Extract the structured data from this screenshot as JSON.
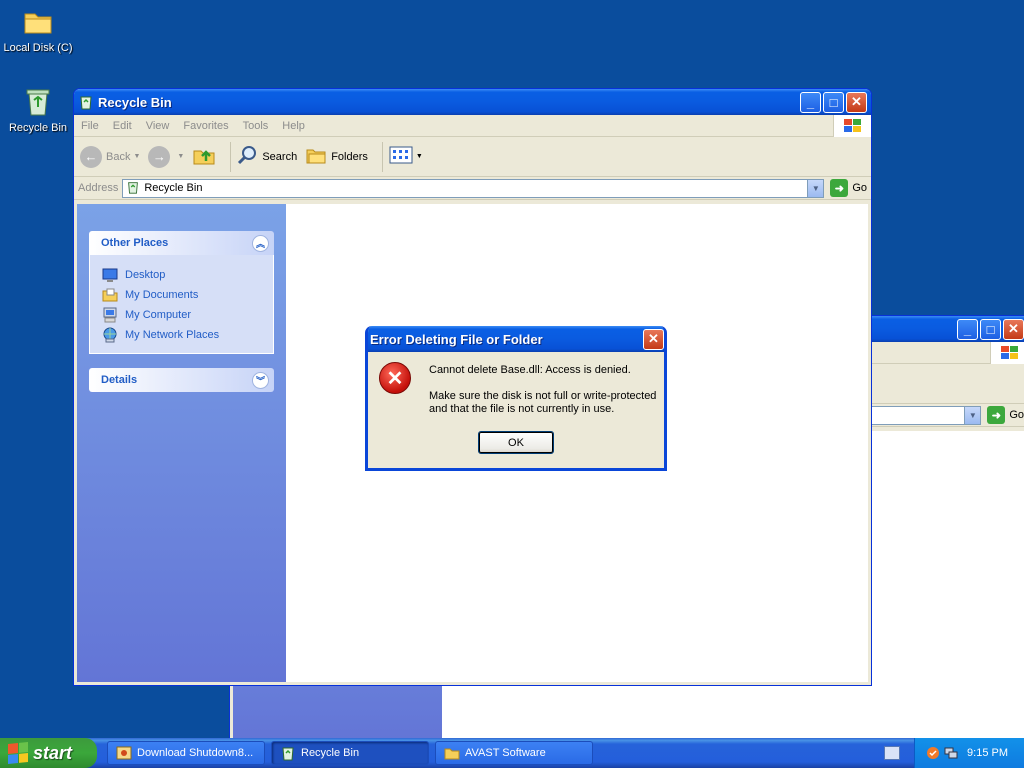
{
  "desktop": {
    "icons": [
      {
        "label": "Local Disk (C)",
        "icon": "folder-icon"
      },
      {
        "label": "Recycle Bin",
        "icon": "recycle-bin-icon"
      }
    ]
  },
  "explorer": {
    "title": "Recycle Bin",
    "menu": [
      "File",
      "Edit",
      "View",
      "Favorites",
      "Tools",
      "Help"
    ],
    "toolbar": {
      "back": "Back",
      "search": "Search",
      "folders": "Folders"
    },
    "address": {
      "label": "Address",
      "value": "Recycle Bin",
      "go": "Go"
    },
    "tasks": {
      "other_places": {
        "title": "Other Places",
        "items": [
          "Desktop",
          "My Documents",
          "My Computer",
          "My Network Places"
        ]
      },
      "details": {
        "title": "Details"
      }
    }
  },
  "background_window": {
    "go": "Go"
  },
  "dialog": {
    "title": "Error Deleting File or Folder",
    "message_line1": "Cannot delete Base.dll: Access is denied.",
    "message_line2": "Make sure the disk is not full or write-protected and that the file is not currently in use.",
    "ok": "OK"
  },
  "taskbar": {
    "start": "start",
    "tasks": [
      "Download Shutdown8...",
      "Recycle Bin",
      "AVAST Software"
    ],
    "clock": "9:15 PM"
  },
  "colors": {
    "desktop": "#0a4d9d",
    "titlebar": "#0a5be0",
    "start_green": "#3ba73b",
    "link_blue": "#215dc6"
  }
}
